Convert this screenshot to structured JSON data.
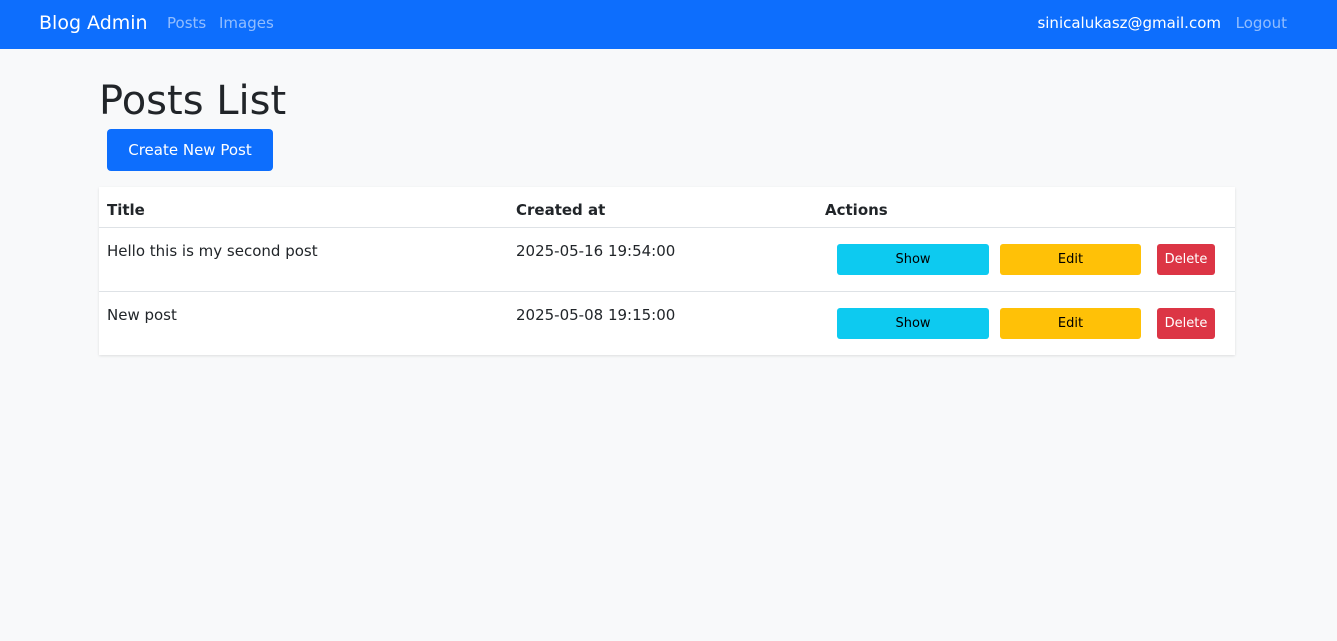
{
  "navbar": {
    "brand": "Blog Admin",
    "links": [
      "Posts",
      "Images"
    ],
    "user_email": "sinicalukasz@gmail.com",
    "logout": "Logout",
    "bg_color": "#0d6efd"
  },
  "page": {
    "title": "Posts List",
    "create_button": "Create New Post"
  },
  "table": {
    "headers": [
      "Title",
      "Created at",
      "Actions"
    ],
    "rows": [
      {
        "title": "Hello this is my second post",
        "created_at": "2025-05-16 19:54:00",
        "actions": [
          "Show",
          "Edit",
          "Delete"
        ]
      },
      {
        "title": "New post",
        "created_at": "2025-05-08 19:15:00",
        "actions": [
          "Show",
          "Edit",
          "Delete"
        ]
      }
    ]
  },
  "colors": {
    "primary": "#0d6efd",
    "info": "#0dcaf0",
    "warning": "#ffc107",
    "danger": "#dc3545"
  }
}
